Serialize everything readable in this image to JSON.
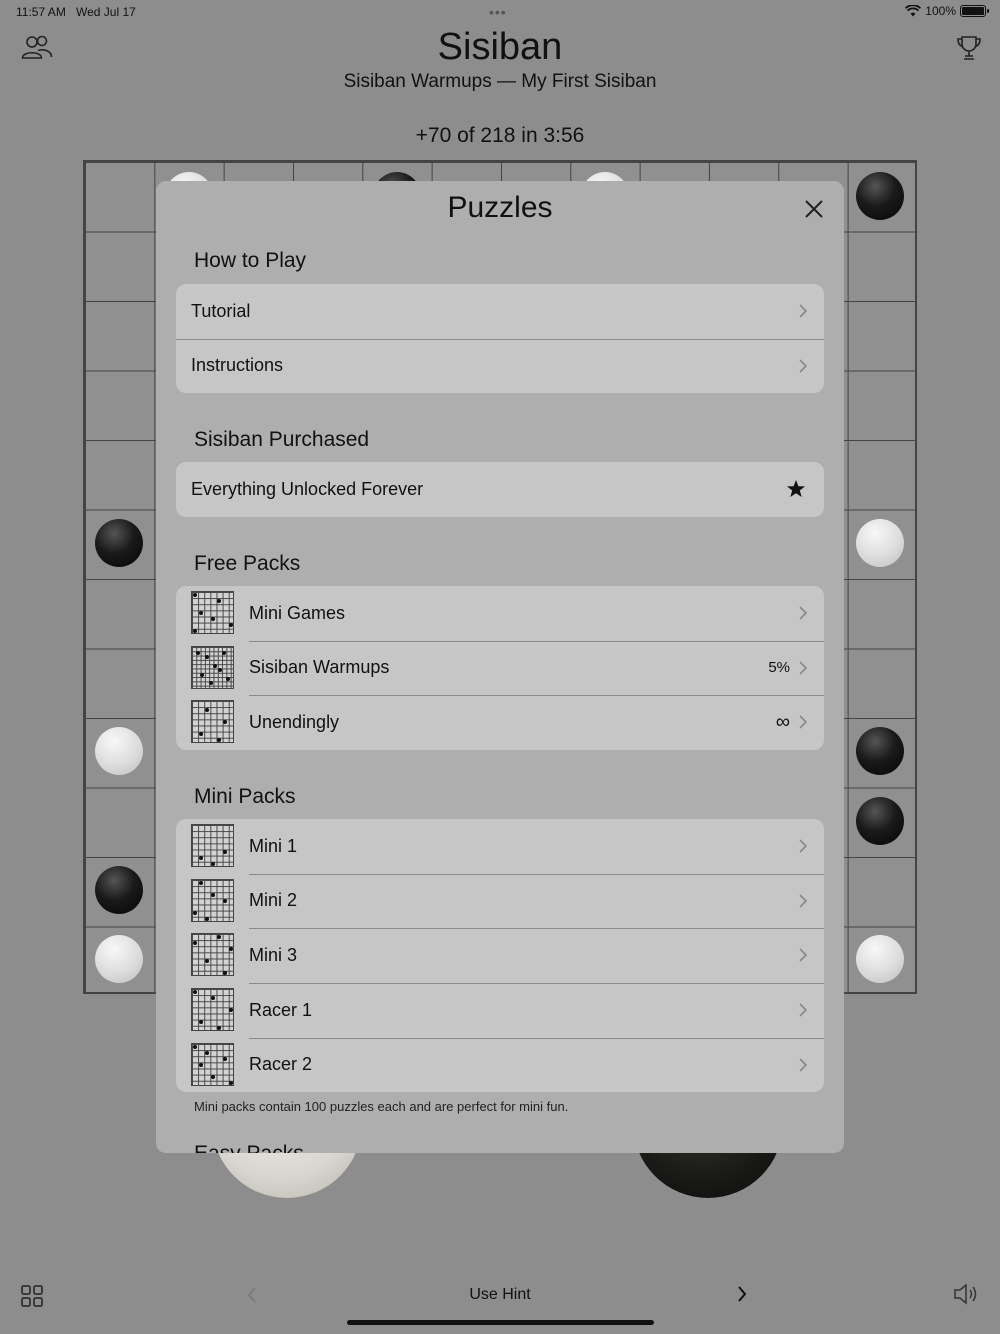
{
  "status_bar": {
    "time": "11:57 AM",
    "date": "Wed Jul 17",
    "battery": "100%"
  },
  "header": {
    "title": "Sisiban",
    "subtitle": "Sisiban Warmups — My First Sisiban",
    "score": "+70 of 218 in 3:56",
    "left_icon": "people-icon",
    "right_icon": "trophy-icon"
  },
  "modal": {
    "title": "Puzzles",
    "sections": [
      {
        "header": "How to Play",
        "rows": [
          {
            "label": "Tutorial"
          },
          {
            "label": "Instructions"
          }
        ]
      },
      {
        "header": "Sisiban Purchased",
        "rows": [
          {
            "label": "Everything Unlocked Forever",
            "icon": "star-icon"
          }
        ]
      },
      {
        "header": "Free Packs",
        "rows": [
          {
            "label": "Mini Games"
          },
          {
            "label": "Sisiban Warmups",
            "value": "5%"
          },
          {
            "label": "Unendingly",
            "value": "∞"
          }
        ]
      },
      {
        "header": "Mini Packs",
        "rows": [
          {
            "label": "Mini 1"
          },
          {
            "label": "Mini 2"
          },
          {
            "label": "Mini 3"
          },
          {
            "label": "Racer 1"
          },
          {
            "label": "Racer 2"
          }
        ]
      }
    ],
    "footnote": "Mini packs contain 100 puzzles each and are perfect for mini fun.",
    "next_section_partial": "Easy Packs"
  },
  "bottom_bar": {
    "hint_label": "Use Hint",
    "left_icon": "grid-icon",
    "right_icon": "speaker-icon",
    "prev_icon": "chevron-left-icon",
    "next_icon": "chevron-right-icon"
  },
  "colors": {
    "background": "#8d8d8d",
    "modal": "#aeaeae",
    "row": "#c6c6c6"
  }
}
